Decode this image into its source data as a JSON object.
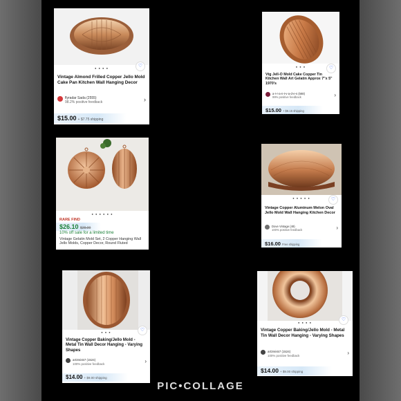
{
  "watermark": "PIC•COLLAGE",
  "cards": [
    {
      "title": "Vintage Almond Frilled Copper Jello Mold Cake Pan Kitchen Wall Hanging Decor",
      "seller_name": "flyradar Sada (2555)",
      "seller_feedback": "98.2% positive feedback",
      "price": "$15.00",
      "shipping": "+ $7.75 shipping"
    },
    {
      "title": "Vtg Jell-O Mold Cake Copper Tin Kitchen Wall Art Gelatin Approx 7\"x 5\" 1970's",
      "seller_name": "a-r-r-a-n-t-v-a-d-e-s (568)",
      "seller_feedback": "99% positive feedback",
      "price": "$15.00",
      "shipping": "+ $8.15 shipping"
    },
    {
      "badge": "RARE FIND",
      "price": "$26.10",
      "old_price": "$29.00",
      "sale_note": "10% off sale for a limited time",
      "title": "Vintage Gelatin Mold Set, 2 Copper Hanging Wall Jello Molds, Copper Decor, Round Fluted"
    },
    {
      "title": "Vintage Copper Aluminum Melon Oval Jello Mold Wall Hanging Kitchen Decor",
      "seller_name": "Dove Vintage (49)",
      "seller_feedback": "100% positive feedback",
      "price": "$16.00",
      "shipping": "Free shipping"
    },
    {
      "title": "Vintage Copper Baking/Jello Mold - Metal Tin Wall Decor Hanging - Varying Shapes",
      "seller_name": "art3mis57 (1524)",
      "seller_feedback": "100% positive feedback",
      "price": "$14.00",
      "shipping": "+ $9.00 shipping"
    },
    {
      "title": "Vintage Copper Baking/Jello Mold - Metal Tin Wall Decor Hanging - Varying Shapes",
      "seller_name": "art3mis57 (1524)",
      "seller_feedback": "100% positive feedback",
      "price": "$14.00",
      "shipping": "+ $9.00 shipping"
    }
  ]
}
